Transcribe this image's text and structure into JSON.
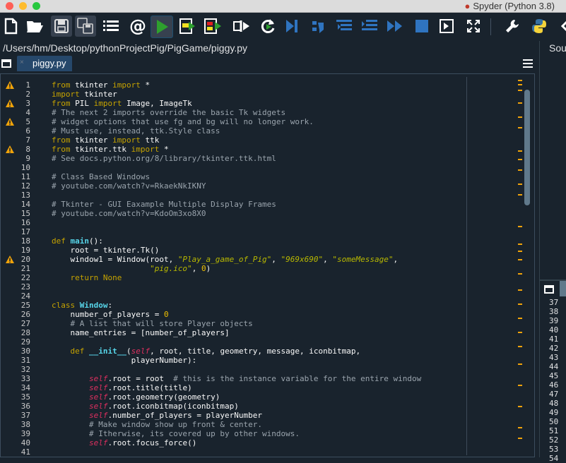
{
  "window": {
    "title": "Spyder (Python 3.8)",
    "traffic_colors": [
      "#fe5f57",
      "#febc2e",
      "#28c840"
    ]
  },
  "toolbar": {
    "buttons": [
      {
        "name": "new-file-icon"
      },
      {
        "name": "open-file-icon"
      },
      {
        "name": "save-file-icon"
      },
      {
        "name": "save-all-icon"
      },
      {
        "name": "outline-icon"
      },
      {
        "name": "at-symbol-icon"
      },
      {
        "name": "run-icon"
      },
      {
        "name": "run-cell-icon"
      },
      {
        "name": "run-cell-advance-icon"
      },
      {
        "name": "run-selection-icon"
      },
      {
        "name": "rerun-icon"
      },
      {
        "name": "debug-icon"
      },
      {
        "name": "step-icon"
      },
      {
        "name": "step-into-icon"
      },
      {
        "name": "step-return-icon"
      },
      {
        "name": "continue-icon"
      },
      {
        "name": "stop-icon"
      },
      {
        "name": "maximize-pane-icon"
      },
      {
        "name": "fullscreen-icon"
      },
      {
        "name": "wrench-icon"
      },
      {
        "name": "python-icon"
      }
    ]
  },
  "path": "/Users/hm/Desktop/pythonProjectPig/PigGame/piggy.py",
  "editor_tab": {
    "label": "piggy.py",
    "close": "×"
  },
  "right_pane": {
    "top_label": "Sou",
    "line_numbers": [
      "37",
      "38",
      "39",
      "40",
      "41",
      "42",
      "43",
      "44",
      "45",
      "46",
      "47",
      "48",
      "49",
      "50",
      "51",
      "52",
      "53",
      "54"
    ]
  },
  "warning_lines": [
    1,
    3,
    5,
    8,
    20
  ],
  "overview_marks": [
    8,
    14,
    22,
    40,
    60,
    75,
    108,
    120,
    135,
    155,
    170,
    215,
    240,
    250,
    262,
    282,
    305,
    325,
    345,
    365,
    385,
    410,
    440,
    470,
    500,
    515
  ],
  "code_lines": [
    {
      "n": "1",
      "t": [
        [
          "kw",
          "from"
        ],
        [
          "",
          " tkinter "
        ],
        [
          "kw",
          "import"
        ],
        [
          "",
          " *"
        ]
      ]
    },
    {
      "n": "2",
      "t": [
        [
          "kw",
          "import"
        ],
        [
          "",
          " tkinter"
        ]
      ]
    },
    {
      "n": "3",
      "t": [
        [
          "kw",
          "from"
        ],
        [
          "",
          " PIL "
        ],
        [
          "kw",
          "import"
        ],
        [
          "",
          " Image, ImageTk"
        ]
      ]
    },
    {
      "n": "4",
      "t": [
        [
          "cm",
          "# The next 2 imports override the basic Tk widgets"
        ]
      ]
    },
    {
      "n": "5",
      "t": [
        [
          "cm",
          "# widget options that use fg and bg will no longer work."
        ]
      ]
    },
    {
      "n": "6",
      "t": [
        [
          "cm",
          "# Must use, instead, ttk.Style class"
        ]
      ]
    },
    {
      "n": "7",
      "t": [
        [
          "kw",
          "from"
        ],
        [
          "",
          " tkinter "
        ],
        [
          "kw",
          "import"
        ],
        [
          "",
          " ttk"
        ]
      ]
    },
    {
      "n": "8",
      "t": [
        [
          "kw",
          "from"
        ],
        [
          "",
          " tkinter.ttk "
        ],
        [
          "kw",
          "import"
        ],
        [
          "",
          " *"
        ]
      ]
    },
    {
      "n": "9",
      "t": [
        [
          "cm",
          "# See docs.python.org/8/library/tkinter.ttk.html"
        ]
      ]
    },
    {
      "n": "10",
      "t": []
    },
    {
      "n": "11",
      "t": [
        [
          "cm",
          "# Class Based Windows"
        ]
      ]
    },
    {
      "n": "12",
      "t": [
        [
          "cm",
          "# youtube.com/watch?v=RkaekNkIKNY"
        ]
      ]
    },
    {
      "n": "13",
      "t": []
    },
    {
      "n": "14",
      "t": [
        [
          "cm",
          "# Tkinter - GUI Eaxample Multiple Display Frames"
        ]
      ]
    },
    {
      "n": "15",
      "t": [
        [
          "cm",
          "# youtube.com/watch?v=KdoOm3xo8X0"
        ]
      ]
    },
    {
      "n": "16",
      "t": []
    },
    {
      "n": "17",
      "t": []
    },
    {
      "n": "18",
      "t": [
        [
          "kw",
          "def"
        ],
        [
          "",
          " "
        ],
        [
          "fn",
          "main"
        ],
        [
          "",
          "():"
        ]
      ]
    },
    {
      "n": "19",
      "t": [
        [
          "",
          "    root = tkinter.Tk()"
        ]
      ]
    },
    {
      "n": "20",
      "t": [
        [
          "",
          "    window1 = Window(root, "
        ],
        [
          "st",
          "\"Play_a_game_of_Pig\""
        ],
        [
          "",
          ", "
        ],
        [
          "st",
          "\"969x690\""
        ],
        [
          "",
          ", "
        ],
        [
          "st",
          "\"someMessage\""
        ],
        [
          "",
          ","
        ]
      ]
    },
    {
      "n": "21",
      "t": [
        [
          "",
          "                     "
        ],
        [
          "st",
          "\"pig.ico\""
        ],
        [
          "",
          ", "
        ],
        [
          "nm",
          "0"
        ],
        [
          "",
          ")"
        ]
      ]
    },
    {
      "n": "22",
      "t": [
        [
          "",
          "    "
        ],
        [
          "kw",
          "return"
        ],
        [
          "",
          " "
        ],
        [
          "kw",
          "None"
        ]
      ]
    },
    {
      "n": "23",
      "t": []
    },
    {
      "n": "24",
      "t": []
    },
    {
      "n": "25",
      "t": [
        [
          "kw",
          "class"
        ],
        [
          "",
          " "
        ],
        [
          "fn",
          "Window"
        ],
        [
          "",
          ":"
        ]
      ]
    },
    {
      "n": "26",
      "t": [
        [
          "",
          "    number_of_players = "
        ],
        [
          "nm",
          "0"
        ]
      ]
    },
    {
      "n": "27",
      "t": [
        [
          "",
          "    "
        ],
        [
          "cm",
          "# A list that will store Player objects"
        ]
      ]
    },
    {
      "n": "28",
      "t": [
        [
          "",
          "    name_entries = [number_of_players]"
        ]
      ]
    },
    {
      "n": "29",
      "t": []
    },
    {
      "n": "30",
      "t": [
        [
          "",
          "    "
        ],
        [
          "kw",
          "def"
        ],
        [
          "",
          " "
        ],
        [
          "fn",
          "__init__"
        ],
        [
          "",
          "("
        ],
        [
          "self",
          "self"
        ],
        [
          "",
          ", root, title, geometry, message, iconbitmap,"
        ]
      ]
    },
    {
      "n": "31",
      "t": [
        [
          "",
          "                 playerNumber):"
        ]
      ]
    },
    {
      "n": "32",
      "t": []
    },
    {
      "n": "33",
      "t": [
        [
          "",
          "        "
        ],
        [
          "self",
          "self"
        ],
        [
          "",
          ".root = root  "
        ],
        [
          "cm",
          "# this is the instance variable for the entire window"
        ]
      ]
    },
    {
      "n": "34",
      "t": [
        [
          "",
          "        "
        ],
        [
          "self",
          "self"
        ],
        [
          "",
          ".root.title(title)"
        ]
      ]
    },
    {
      "n": "35",
      "t": [
        [
          "",
          "        "
        ],
        [
          "self",
          "self"
        ],
        [
          "",
          ".root.geometry(geometry)"
        ]
      ]
    },
    {
      "n": "36",
      "t": [
        [
          "",
          "        "
        ],
        [
          "self",
          "self"
        ],
        [
          "",
          ".root.iconbitmap(iconbitmap)"
        ]
      ]
    },
    {
      "n": "37",
      "t": [
        [
          "",
          "        "
        ],
        [
          "self",
          "self"
        ],
        [
          "",
          ".number_of_players = playerNumber"
        ]
      ]
    },
    {
      "n": "38",
      "t": [
        [
          "",
          "        "
        ],
        [
          "cm",
          "# Make window show up front & center."
        ]
      ]
    },
    {
      "n": "39",
      "t": [
        [
          "",
          "        "
        ],
        [
          "cm",
          "# Itherwise, its covered up by other windows."
        ]
      ]
    },
    {
      "n": "40",
      "t": [
        [
          "",
          "        "
        ],
        [
          "self",
          "self"
        ],
        [
          "",
          ".root.focus_force()"
        ]
      ]
    },
    {
      "n": "41",
      "t": []
    }
  ]
}
